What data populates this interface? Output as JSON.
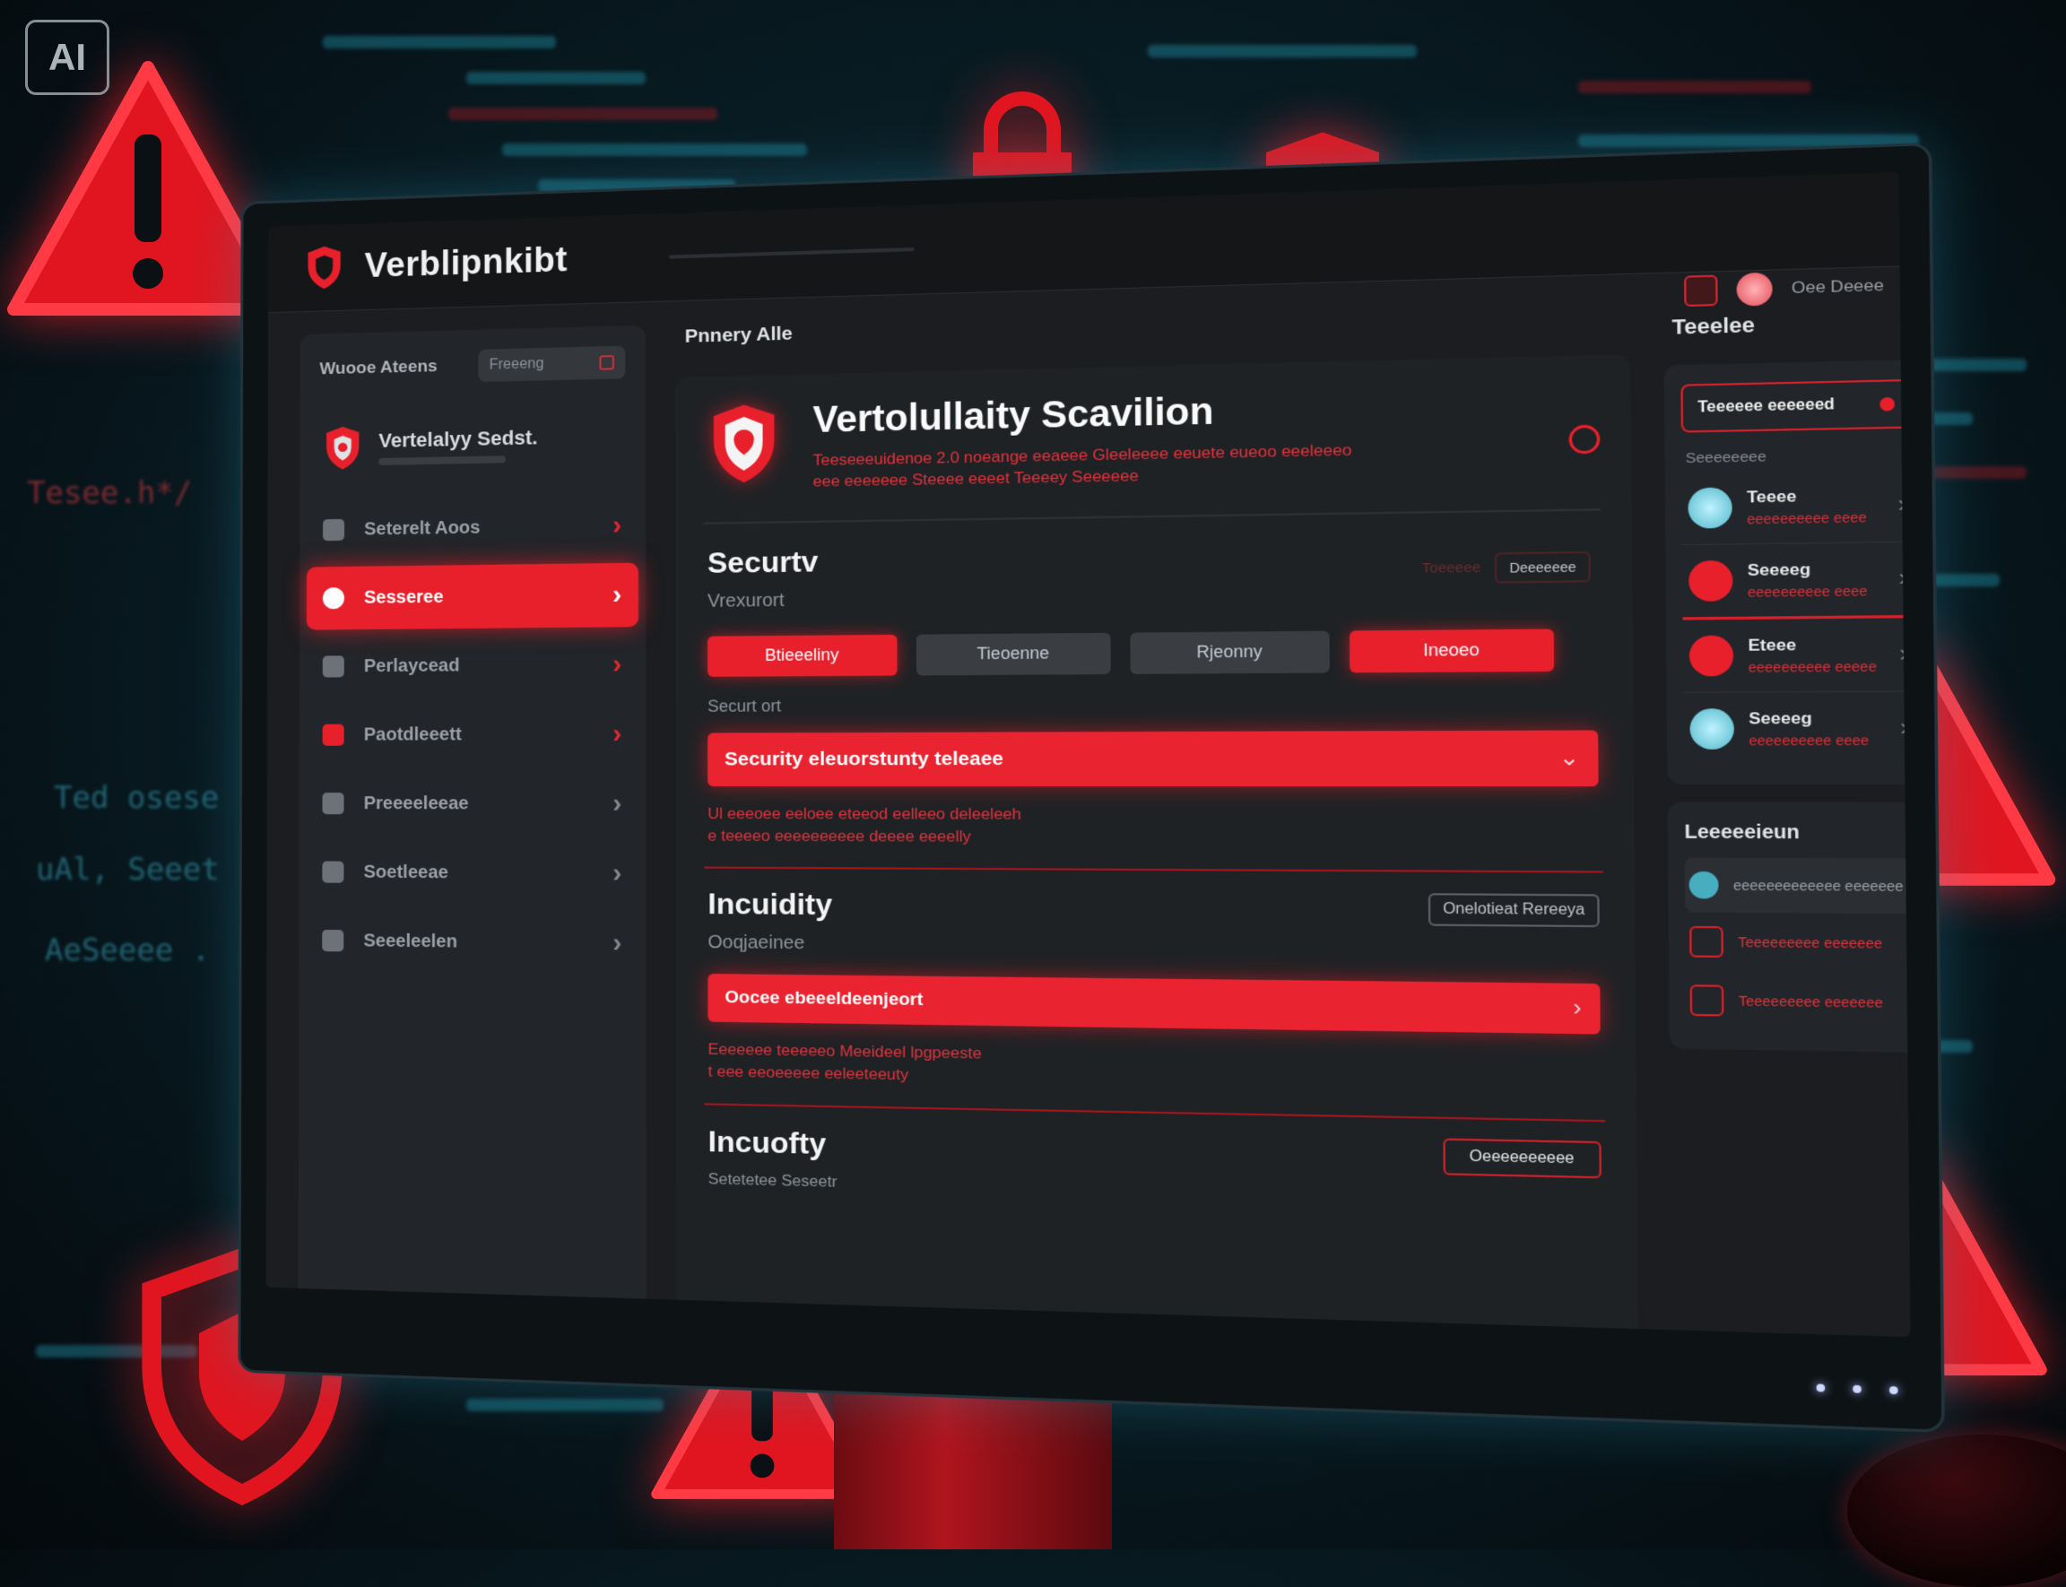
{
  "watermark": "AI",
  "background": {
    "code_snippets": [
      "Tesee.h*/",
      "Ted osese",
      "uAl, Seeet",
      "AeSeeee ."
    ],
    "accent_color": "#e8202c",
    "code_color": "#36a6bd"
  },
  "app": {
    "name": "Verblipnkibt",
    "logo_icon": "shield-icon"
  },
  "sidebar": {
    "title": "Wuooe Ateens",
    "filter_label": "Freeeng",
    "brand": {
      "name": "Vertelalyy Sedst."
    },
    "items": [
      {
        "label": "Seterelt Aoos",
        "icon": "dashboard-icon",
        "active": false
      },
      {
        "label": "Sesseree",
        "icon": "shield-icon",
        "active": true
      },
      {
        "label": "Perlaycead",
        "icon": "document-icon",
        "active": false
      },
      {
        "label": "Paotdleeett",
        "icon": "alert-icon",
        "active": false
      },
      {
        "label": "Preeeeleeae",
        "icon": "users-icon",
        "active": false
      },
      {
        "label": "Soetleeae",
        "icon": "grid-icon",
        "active": false
      },
      {
        "label": "Seeeleelen",
        "icon": "user-icon",
        "active": false
      }
    ]
  },
  "main": {
    "breadcrumb": "Pnnery Alle",
    "header": {
      "title": "Vertolullaity Scavilion",
      "description": "Teeseeeuidenoe 2.0 noeange eeaeee Gleeleeee eeuete eueoo eeeleeeo eee eeeeeee Steeee eeeet Teeeey Seeeeee",
      "status_icon": "ring-icon"
    },
    "security": {
      "title": "Securtv",
      "subtitle": "Vrexurort",
      "tools_label": "Toeeeee",
      "tools_value": "Deeeeeee",
      "tabs": [
        {
          "label": "Btieeeliny",
          "style": "red"
        },
        {
          "label": "Tieoenne",
          "style": "gray"
        },
        {
          "label": "Rjeonny",
          "style": "gray"
        },
        {
          "label": "Ineoeo",
          "style": "red"
        }
      ],
      "section_label": "Securt ort",
      "alert_bar": "Security eleuorstunty teleaee",
      "note_lines": [
        "Ul eeeoee eeloee eteeod eelleeo deleeleeh",
        "e teeeeo eeeeeeeeee deeee eeeelly"
      ]
    },
    "incuidity": {
      "title": "Incuidity",
      "action": "Onelotieat Rereeya",
      "subtitle": "Ooqjaeinee",
      "alert_bar": "Oocee ebeeeldeenjeort",
      "note_lines": [
        "Eeeeeee teeeeeo Meeideel lpgpeeste",
        "t eee eeoeeeee eeleeteeuty"
      ]
    },
    "incuofty": {
      "title": "Incuofty",
      "action": "Oeeeeeeeeee",
      "subtitle": "Setetetee Seseetr"
    }
  },
  "topbar": {
    "user_name": "Oee Deeee"
  },
  "right_panel": {
    "title": "Teeelee",
    "alert": "Teeeeee eeeeeed",
    "section": "Seeeeeeee",
    "items": [
      {
        "name": "Teeee",
        "meta": "eeeeeeeeee eeee",
        "color": "teal"
      },
      {
        "name": "Seeeeg",
        "meta": "eeeeeeeeee eeee",
        "color": "red"
      },
      {
        "name": "Eteee",
        "meta": "eeeeeeeeee eeeee",
        "color": "red"
      },
      {
        "name": "Seeeeg",
        "meta": "eeeeeeeeee eeee",
        "color": "teal"
      }
    ],
    "card2_title": "Leeeeeieun",
    "card2_items": [
      {
        "text": "eeeeeeeeeeeee eeeeeee",
        "color": "teal"
      },
      {
        "text": "Teeeeeeeee eeeeeee",
        "color": "red"
      },
      {
        "text": "Teeeeeeeee eeeeeee",
        "color": "red"
      }
    ]
  }
}
